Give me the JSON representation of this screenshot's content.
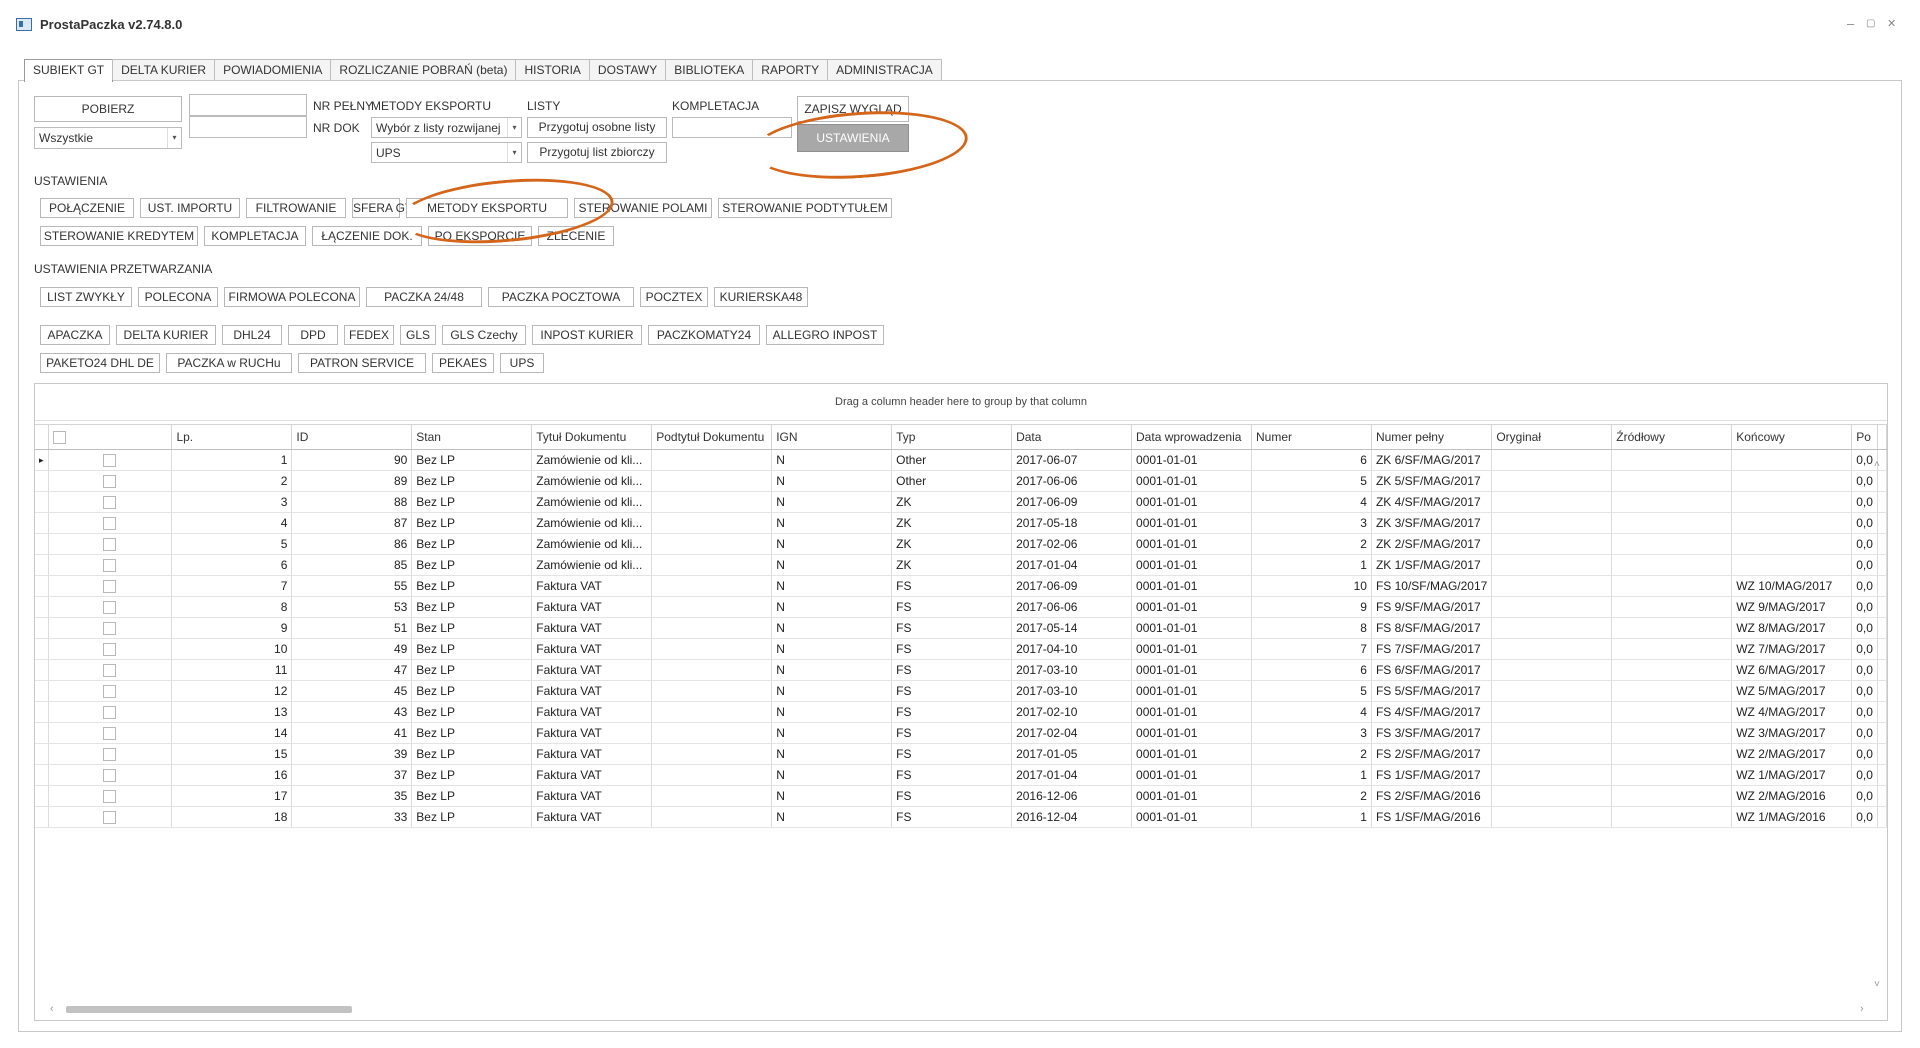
{
  "window": {
    "title": "ProstaPaczka v2.74.8.0",
    "minimize": "–",
    "restore": "▢",
    "close": "✕"
  },
  "tabs": [
    "SUBIEKT GT",
    "DELTA KURIER",
    "POWIADOMIENIA",
    "ROZLICZANIE POBRAŃ (beta)",
    "HISTORIA",
    "DOSTAWY",
    "BIBLIOTEKA",
    "RAPORTY",
    "ADMINISTRACJA"
  ],
  "toolbar": {
    "pobierz": "POBIERZ",
    "filter_value": "Wszystkie",
    "nr_pelny_label": "NR PEŁNY",
    "nr_dok_label": "NR DOK",
    "nr_pelny_value": "",
    "nr_dok_value": "",
    "metody_label": "METODY EKSPORTU",
    "metody_value": "Wybór z listy rozwijanej",
    "metody_value2": "UPS",
    "listy_label": "LISTY",
    "przygotuj_osobne": "Przygotuj osobne listy",
    "przygotuj_zbiorczy": "Przygotuj list zbiorczy",
    "kompletacja_label": "KOMPLETACJA",
    "kompletacja_value": "",
    "zapisz_wyglad": "ZAPISZ WYGLĄD",
    "ustawienia": "USTAWIENIA"
  },
  "settings": {
    "title": "USTAWIENIA",
    "row1": [
      "POŁĄCZENIE",
      "UST. IMPORTU",
      "FILTROWANIE",
      "SFERA GT",
      "METODY EKSPORTU",
      "STEROWANIE POLAMI",
      "STEROWANIE PODTYTUŁEM"
    ],
    "row2": [
      "STEROWANIE KREDYTEM",
      "KOMPLETACJA",
      "ŁĄCZENIE DOK.",
      "PO EKSPORCIE",
      "ZLECENIE"
    ]
  },
  "processing": {
    "title": "USTAWIENIA PRZETWARZANIA",
    "row1": [
      "LIST ZWYKŁY",
      "POLECONA",
      "FIRMOWA POLECONA",
      "PACZKA 24/48",
      "PACZKA POCZTOWA",
      "POCZTEX",
      "KURIERSKA48"
    ],
    "row2": [
      "APACZKA",
      "DELTA KURIER",
      "DHL24",
      "DPD",
      "FEDEX",
      "GLS",
      "GLS Czechy",
      "INPOST KURIER",
      "PACZKOMATY24",
      "ALLEGRO INPOST"
    ],
    "row3": [
      "PAKETO24 DHL DE",
      "PACZKA w RUCHu",
      "PATRON SERVICE",
      "PEKAES",
      "UPS"
    ]
  },
  "grid": {
    "group_hint": "Drag a column header here to group by that column",
    "columns": [
      "Lp.",
      "ID",
      "Stan",
      "Tytuł Dokumentu",
      "Podtytuł Dokumentu",
      "IGN",
      "Typ",
      "Data",
      "Data wprowadzenia",
      "Numer",
      "Numer pełny",
      "Oryginał",
      "Źródłowy",
      "Końcowy",
      "Po"
    ],
    "rows": [
      [
        "1",
        "90",
        "Bez LP",
        "Zamówienie od kli...",
        "",
        "N",
        "Other",
        "2017-06-07",
        "0001-01-01",
        "6",
        "ZK 6/SF/MAG/2017",
        "",
        "",
        "",
        "0,0"
      ],
      [
        "2",
        "89",
        "Bez LP",
        "Zamówienie od kli...",
        "",
        "N",
        "Other",
        "2017-06-06",
        "0001-01-01",
        "5",
        "ZK 5/SF/MAG/2017",
        "",
        "",
        "",
        "0,0"
      ],
      [
        "3",
        "88",
        "Bez LP",
        "Zamówienie od kli...",
        "",
        "N",
        "ZK",
        "2017-06-09",
        "0001-01-01",
        "4",
        "ZK 4/SF/MAG/2017",
        "",
        "",
        "",
        "0,0"
      ],
      [
        "4",
        "87",
        "Bez LP",
        "Zamówienie od kli...",
        "",
        "N",
        "ZK",
        "2017-05-18",
        "0001-01-01",
        "3",
        "ZK 3/SF/MAG/2017",
        "",
        "",
        "",
        "0,0"
      ],
      [
        "5",
        "86",
        "Bez LP",
        "Zamówienie od kli...",
        "",
        "N",
        "ZK",
        "2017-02-06",
        "0001-01-01",
        "2",
        "ZK 2/SF/MAG/2017",
        "",
        "",
        "",
        "0,0"
      ],
      [
        "6",
        "85",
        "Bez LP",
        "Zamówienie od kli...",
        "",
        "N",
        "ZK",
        "2017-01-04",
        "0001-01-01",
        "1",
        "ZK 1/SF/MAG/2017",
        "",
        "",
        "",
        "0,0"
      ],
      [
        "7",
        "55",
        "Bez LP",
        "Faktura VAT",
        "",
        "N",
        "FS",
        "2017-06-09",
        "0001-01-01",
        "10",
        "FS 10/SF/MAG/2017",
        "",
        "",
        "WZ 10/MAG/2017",
        "0,0"
      ],
      [
        "8",
        "53",
        "Bez LP",
        "Faktura VAT",
        "",
        "N",
        "FS",
        "2017-06-06",
        "0001-01-01",
        "9",
        "FS 9/SF/MAG/2017",
        "",
        "",
        "WZ 9/MAG/2017",
        "0,0"
      ],
      [
        "9",
        "51",
        "Bez LP",
        "Faktura VAT",
        "",
        "N",
        "FS",
        "2017-05-14",
        "0001-01-01",
        "8",
        "FS 8/SF/MAG/2017",
        "",
        "",
        "WZ 8/MAG/2017",
        "0,0"
      ],
      [
        "10",
        "49",
        "Bez LP",
        "Faktura VAT",
        "",
        "N",
        "FS",
        "2017-04-10",
        "0001-01-01",
        "7",
        "FS 7/SF/MAG/2017",
        "",
        "",
        "WZ 7/MAG/2017",
        "0,0"
      ],
      [
        "11",
        "47",
        "Bez LP",
        "Faktura VAT",
        "",
        "N",
        "FS",
        "2017-03-10",
        "0001-01-01",
        "6",
        "FS 6/SF/MAG/2017",
        "",
        "",
        "WZ 6/MAG/2017",
        "0,0"
      ],
      [
        "12",
        "45",
        "Bez LP",
        "Faktura VAT",
        "",
        "N",
        "FS",
        "2017-03-10",
        "0001-01-01",
        "5",
        "FS 5/SF/MAG/2017",
        "",
        "",
        "WZ 5/MAG/2017",
        "0,0"
      ],
      [
        "13",
        "43",
        "Bez LP",
        "Faktura VAT",
        "",
        "N",
        "FS",
        "2017-02-10",
        "0001-01-01",
        "4",
        "FS 4/SF/MAG/2017",
        "",
        "",
        "WZ 4/MAG/2017",
        "0,0"
      ],
      [
        "14",
        "41",
        "Bez LP",
        "Faktura VAT",
        "",
        "N",
        "FS",
        "2017-02-04",
        "0001-01-01",
        "3",
        "FS 3/SF/MAG/2017",
        "",
        "",
        "WZ 3/MAG/2017",
        "0,0"
      ],
      [
        "15",
        "39",
        "Bez LP",
        "Faktura VAT",
        "",
        "N",
        "FS",
        "2017-01-05",
        "0001-01-01",
        "2",
        "FS 2/SF/MAG/2017",
        "",
        "",
        "WZ 2/MAG/2017",
        "0,0"
      ],
      [
        "16",
        "37",
        "Bez LP",
        "Faktura VAT",
        "",
        "N",
        "FS",
        "2017-01-04",
        "0001-01-01",
        "1",
        "FS 1/SF/MAG/2017",
        "",
        "",
        "WZ 1/MAG/2017",
        "0,0"
      ],
      [
        "17",
        "35",
        "Bez LP",
        "Faktura VAT",
        "",
        "N",
        "FS",
        "2016-12-06",
        "0001-01-01",
        "2",
        "FS 2/SF/MAG/2016",
        "",
        "",
        "WZ 2/MAG/2016",
        "0,0"
      ],
      [
        "18",
        "33",
        "Bez LP",
        "Faktura VAT",
        "",
        "N",
        "FS",
        "2016-12-04",
        "0001-01-01",
        "1",
        "FS 1/SF/MAG/2016",
        "",
        "",
        "WZ 1/MAG/2016",
        "0,0"
      ]
    ]
  },
  "colors": {
    "highlight": "#d4661c",
    "button_active": "#a8a8a8"
  },
  "icons": {
    "row_indicator": "▸",
    "dropdown": "▾",
    "scroll_left": "‹",
    "scroll_right": "›",
    "scroll_up": "˄",
    "scroll_down": "˅"
  }
}
